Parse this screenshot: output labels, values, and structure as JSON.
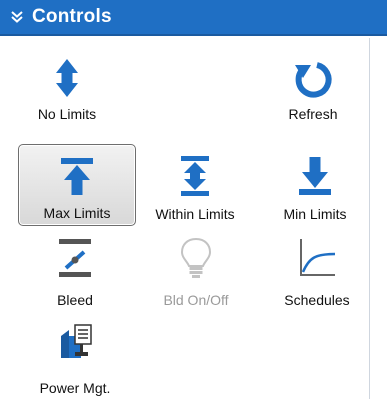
{
  "panel": {
    "title": "Controls",
    "header_color": "#1f6fc4",
    "icon_color": "#1f6fc4",
    "collapse_icon": "double-chevron-down-icon"
  },
  "tools": [
    {
      "label": "No Limits",
      "icon": "up-down-arrows-icon",
      "selected": false,
      "enabled": true
    },
    {
      "label": "Refresh",
      "icon": "refresh-icon",
      "selected": false,
      "enabled": true
    },
    {
      "label": "Max Limits",
      "icon": "max-limit-icon",
      "selected": true,
      "enabled": true
    },
    {
      "label": "Within Limits",
      "icon": "within-limits-icon",
      "selected": false,
      "enabled": true
    },
    {
      "label": "Min Limits",
      "icon": "min-limit-icon",
      "selected": false,
      "enabled": true
    },
    {
      "label": "Bleed",
      "icon": "bleed-icon",
      "selected": false,
      "enabled": true
    },
    {
      "label": "Bld On/Off",
      "icon": "light-bulb-icon",
      "selected": false,
      "enabled": false
    },
    {
      "label": "Schedules",
      "icon": "schedule-curve-icon",
      "selected": false,
      "enabled": true
    },
    {
      "label": "Power Mgt.",
      "icon": "power-management-icon",
      "selected": false,
      "enabled": true
    }
  ]
}
